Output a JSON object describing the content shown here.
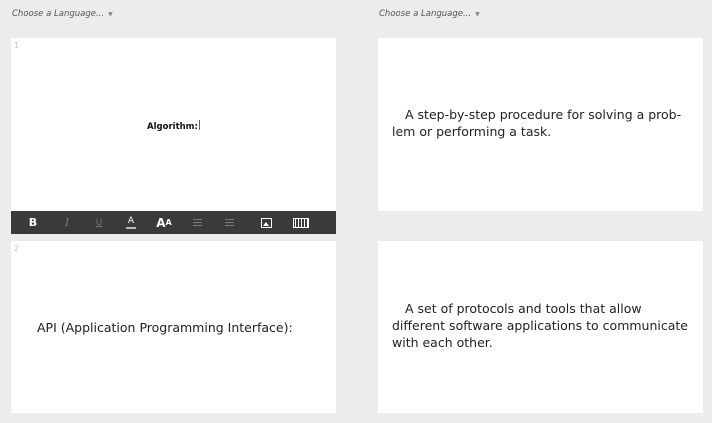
{
  "language_selectors": [
    {
      "label": "Choose a Language...",
      "caret": "▼"
    },
    {
      "label": "Choose a Language...",
      "caret": "▼"
    }
  ],
  "cards": [
    {
      "number": "1",
      "term": "Algorithm:",
      "definition": "A step-by-step procedure for solving a prob-lem or performing a task."
    },
    {
      "number": "2",
      "term": "API (Application Programming Interface):",
      "definition": "A set of protocols and tools that allow different software applications to communicate with each other."
    }
  ],
  "toolbar": {
    "bold": "B",
    "italic": "I",
    "underline": "U",
    "color": "A",
    "size_big": "A",
    "size_small": "A"
  }
}
